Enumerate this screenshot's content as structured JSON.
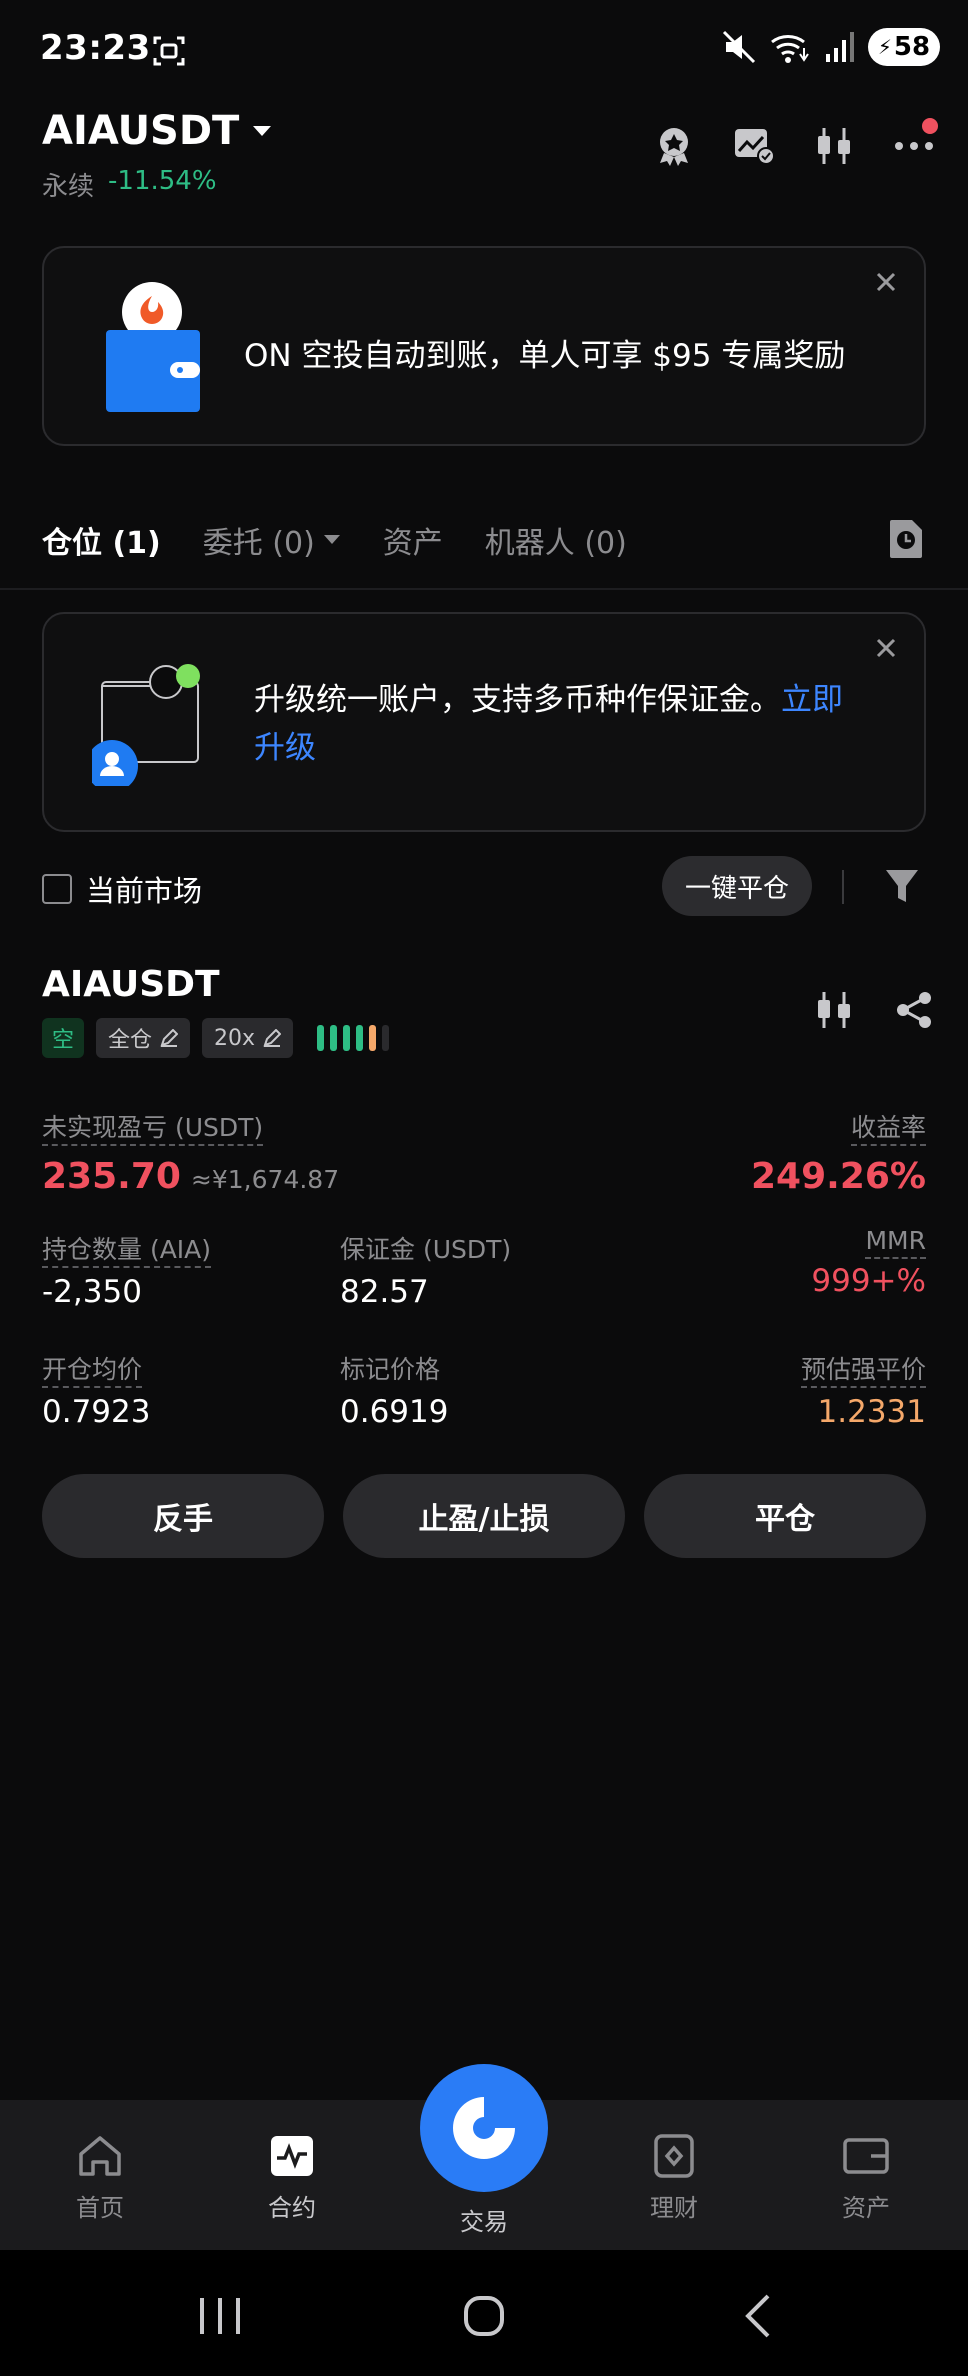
{
  "status_bar": {
    "time": "23:23",
    "battery": "58"
  },
  "header": {
    "pair": "AIAUSDT",
    "type": "永续",
    "change": "-11.54%"
  },
  "banner1": {
    "text": "ON 空投自动到账，单人可享 $95 专属奖励"
  },
  "tabs": [
    {
      "label": "仓位 (1)"
    },
    {
      "label": "委托 (0)"
    },
    {
      "label": "资产"
    },
    {
      "label": "机器人 (0)"
    }
  ],
  "banner2": {
    "text": "升级统一账户，支持多币种作保证金。",
    "link": "立即升级"
  },
  "filter": {
    "current_market": "当前市场",
    "close_all": "一键平仓"
  },
  "position": {
    "symbol": "AIAUSDT",
    "side_tag": "空",
    "margin_mode": "全仓",
    "leverage": "20x",
    "risk_level_colors": [
      "#2ebd85",
      "#2ebd85",
      "#2ebd85",
      "#2ebd85",
      "#f5a86a",
      "#2a2a2d"
    ],
    "unrealized_pnl_label": "未实现盈亏 (USDT)",
    "unrealized_pnl": "235.70",
    "unrealized_pnl_cny": "≈¥1,674.87",
    "roe_label": "收益率",
    "roe": "249.26%",
    "size_label": "持仓数量 (AIA)",
    "size": "-2,350",
    "margin_label": "保证金 (USDT)",
    "margin": "82.57",
    "mmr_label": "MMR",
    "mmr": "999+%",
    "entry_label": "开仓均价",
    "entry": "0.7923",
    "mark_label": "标记价格",
    "mark": "0.6919",
    "liq_label": "预估强平价",
    "liq": "1.2331"
  },
  "actions": {
    "reverse": "反手",
    "tpsl": "止盈/止损",
    "close": "平仓"
  },
  "bottom_nav": [
    {
      "label": "首页",
      "icon": "home-icon"
    },
    {
      "label": "合约",
      "icon": "futures-icon"
    },
    {
      "label": "交易",
      "icon": "trade-icon"
    },
    {
      "label": "理财",
      "icon": "earn-icon"
    },
    {
      "label": "资产",
      "icon": "wallet-icon"
    }
  ],
  "colors": {
    "accent": "#2a7cf6",
    "positive": "#2ebd85",
    "negative": "#f0515f",
    "warning": "#f5a86a"
  }
}
